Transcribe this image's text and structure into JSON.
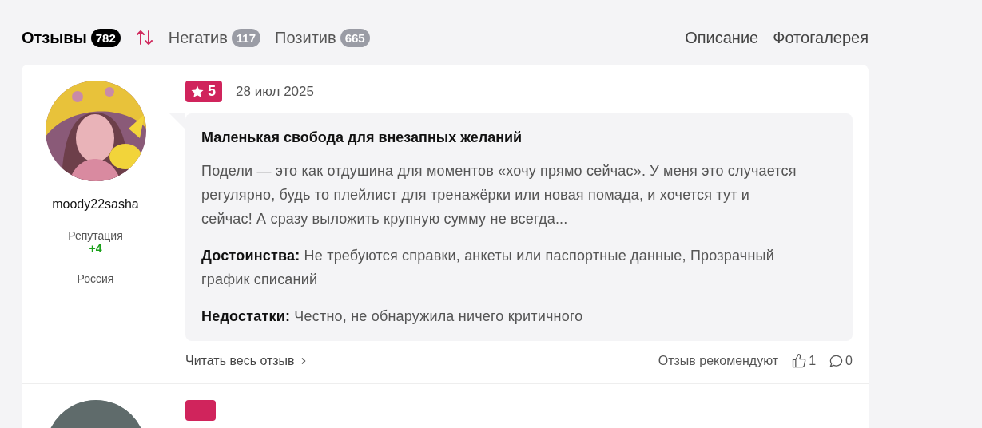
{
  "tabs": [
    {
      "label": "Отзывы",
      "count": "782",
      "selected": true
    },
    {
      "label": "Негатив",
      "count": "117",
      "selected": false
    },
    {
      "label": "Позитив",
      "count": "665",
      "selected": false
    }
  ],
  "nav_links": [
    "Описание",
    "Фотогалерея"
  ],
  "review": {
    "author": "moody22sasha",
    "reputation_label": "Репутация",
    "reputation": "+4",
    "country": "Россия",
    "rating": "5",
    "date": "28 июл 2025",
    "title": "Маленькая свобода для внезапных желаний",
    "text": "Подели — это как отдушина для моментов «хочу прямо сейчас». У меня это случается регулярно, будь то плейлист для тренажёрки или новая помада, и хочется тут и сейчас! А сразу выложить крупную сумму не всегда...",
    "pros_label": "Достоинства:",
    "pros": "Не требуются справки, анкеты или паспортные данные, Прозрачный график списаний",
    "cons_label": "Недостатки:",
    "cons": "Честно, не обнаружила ничего критичного",
    "read_more": "Читать весь отзыв",
    "recommend_label": "Отзыв рекомендуют",
    "likes": "1",
    "comments": "0"
  }
}
